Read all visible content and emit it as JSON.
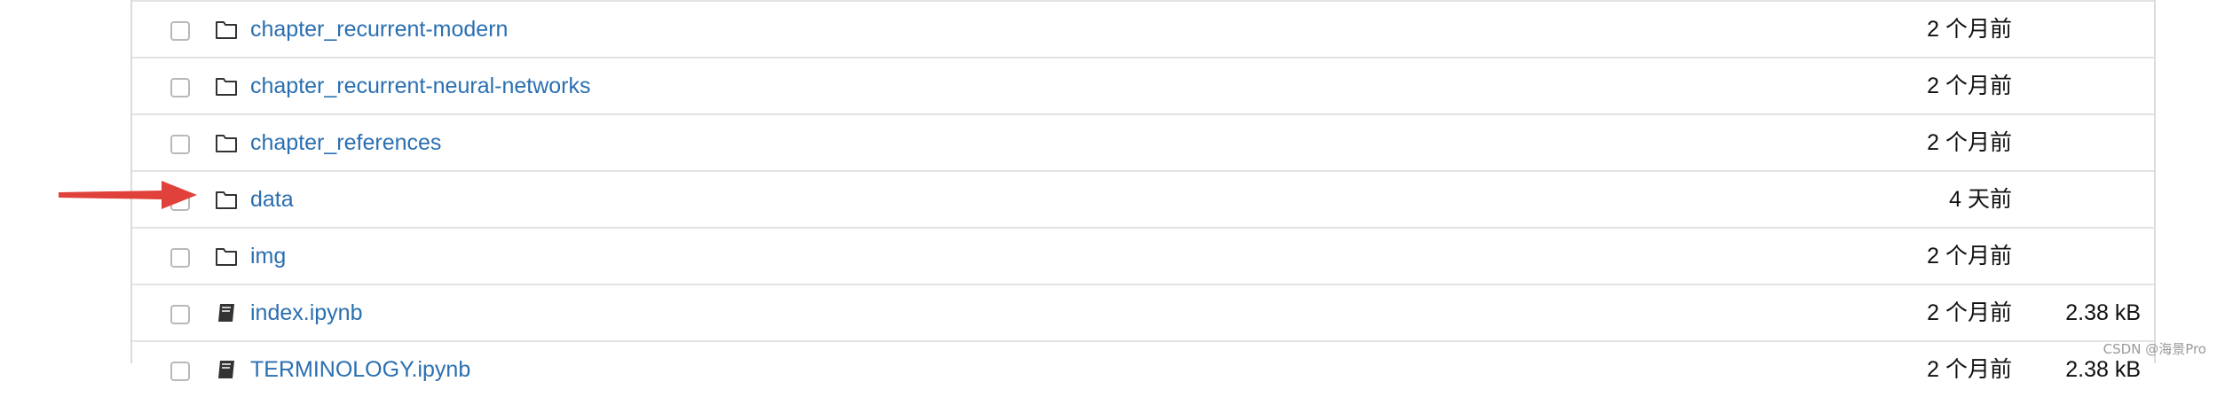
{
  "file_list": {
    "rows": [
      {
        "name": "chapter_recurrent-modern",
        "type": "folder",
        "modified": "2 个月前",
        "size": ""
      },
      {
        "name": "chapter_recurrent-neural-networks",
        "type": "folder",
        "modified": "2 个月前",
        "size": ""
      },
      {
        "name": "chapter_references",
        "type": "folder",
        "modified": "2 个月前",
        "size": ""
      },
      {
        "name": "data",
        "type": "folder",
        "modified": "4 天前",
        "size": ""
      },
      {
        "name": "img",
        "type": "folder",
        "modified": "2 个月前",
        "size": ""
      },
      {
        "name": "index.ipynb",
        "type": "notebook",
        "modified": "2 个月前",
        "size": "2.38 kB"
      },
      {
        "name": "TERMINOLOGY.ipynb",
        "type": "notebook",
        "modified": "2 个月前",
        "size": "2.38 kB"
      }
    ]
  },
  "annotation": {
    "arrow_color": "#e0413a",
    "arrow_target": "data"
  },
  "watermark": "CSDN @海景Pro",
  "colors": {
    "link": "#2a6fb0",
    "border": "#e3e3e3",
    "text": "#111111"
  }
}
